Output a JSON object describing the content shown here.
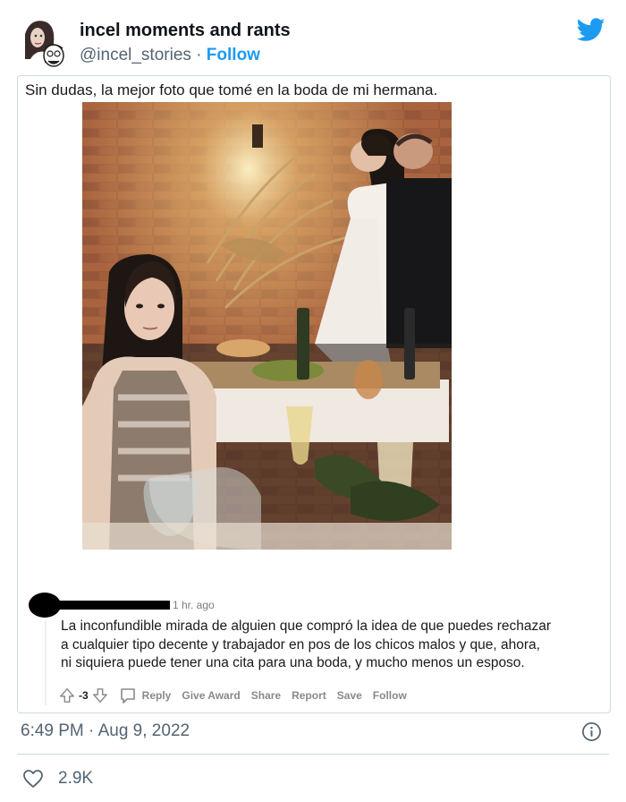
{
  "header": {
    "display_name": "incel moments and rants",
    "handle": "@incel_stories",
    "separator": "·",
    "follow_label": "Follow"
  },
  "post": {
    "title": "Sin dudas, la mejor foto que tomé en la boda de mi hermana."
  },
  "comment": {
    "time_ago": "1 hr. ago",
    "lines": [
      "La inconfundible mirada de alguien que compró la idea de que puedes rechazar",
      "a cualquier tipo decente y trabajador en pos de los chicos malos y que, ahora,",
      "ni siquiera puede tener una cita para una boda, y mucho menos un esposo."
    ],
    "vote_count": "-3",
    "actions": [
      "Reply",
      "Give Award",
      "Share",
      "Report",
      "Save",
      "Follow"
    ]
  },
  "footer": {
    "timestamp": "6:49 PM · Aug 9, 2022",
    "likes": "2.9K"
  },
  "icons": {
    "brand": "twitter-bird-icon",
    "info": "info-icon",
    "like": "heart-icon",
    "upvote": "upvote-arrow-icon",
    "downvote": "downvote-arrow-icon",
    "reply": "speech-bubble-icon"
  },
  "colors": {
    "twitter_blue": "#1d9bf0",
    "text_secondary": "#536471",
    "reddit_gray": "#878a8c",
    "border": "#cfd9de"
  }
}
